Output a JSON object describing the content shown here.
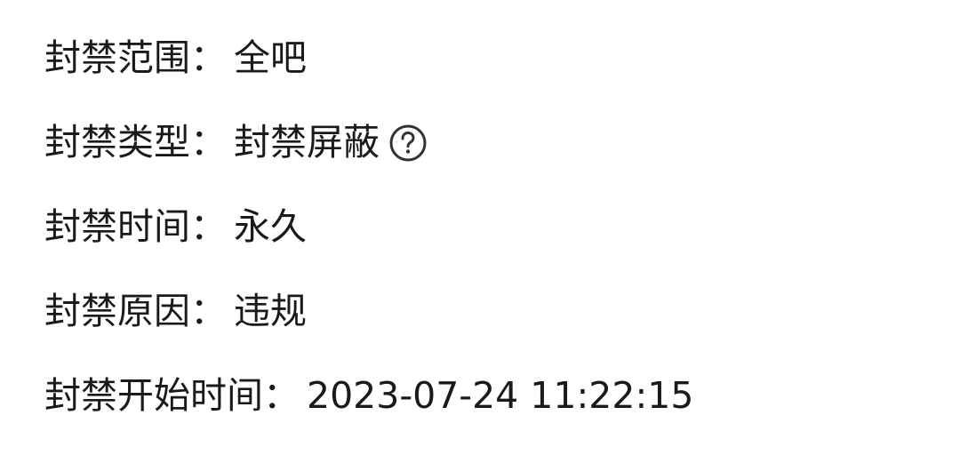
{
  "ban_info": {
    "rows": [
      {
        "label": "封禁范围：",
        "value": "全吧"
      },
      {
        "label": "封禁类型：",
        "value": "封禁屏蔽"
      },
      {
        "label": "封禁时间：",
        "value": "永久"
      },
      {
        "label": "封禁原因：",
        "value": "违规"
      },
      {
        "label": "封禁开始时间：",
        "value": "2023-07-24 11:22:15"
      }
    ],
    "help_icon": "question-circle-icon"
  }
}
